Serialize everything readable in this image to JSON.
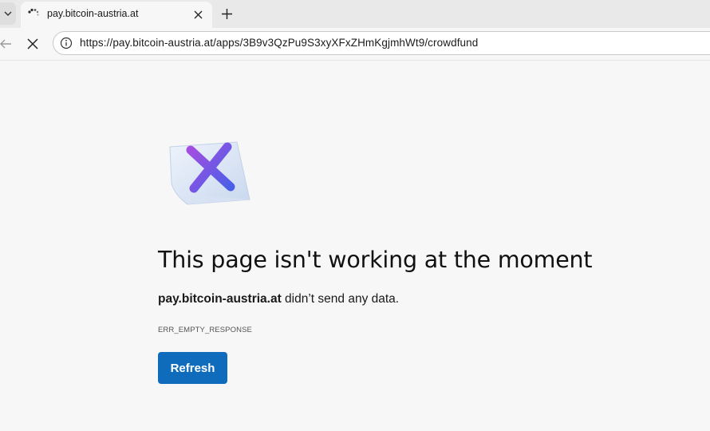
{
  "browser": {
    "tab": {
      "title": "pay.bitcoin-austria.at",
      "spinner_icon": "loading-spinner-icon",
      "close_icon": "close-icon"
    },
    "new_tab_icon": "plus-icon",
    "tab_list_icon": "chevron-down-icon",
    "toolbar": {
      "back_icon": "arrow-left-icon",
      "stop_icon": "close-icon",
      "site_info_icon": "info-icon",
      "url": "https://pay.bitcoin-austria.at/apps/3B9v3QzPu9S3xyXFxZHmKgjmhWt9/crowdfund"
    }
  },
  "error_page": {
    "illustration_icon": "broken-page-x-icon",
    "heading": "This page isn't working at the moment",
    "host": "pay.bitcoin-austria.at",
    "message_suffix": " didn’t send any data.",
    "error_code": "ERR_EMPTY_RESPONSE",
    "refresh_label": "Refresh"
  },
  "colors": {
    "primary_button": "#0f6cbd",
    "page_background": "#f7f7f7",
    "x_gradient_start": "#a24ee0",
    "x_gradient_end": "#4a5fe8"
  }
}
